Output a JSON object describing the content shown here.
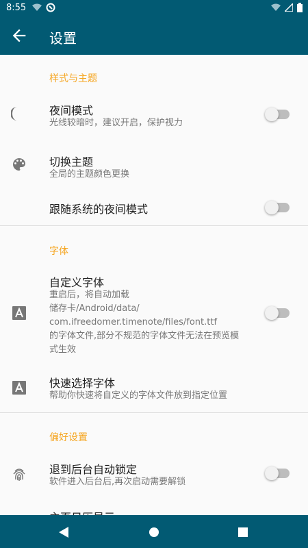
{
  "statusbar": {
    "time": "8:55"
  },
  "appbar": {
    "title": "设置"
  },
  "sections": {
    "style": {
      "title": "样式与主题"
    },
    "font": {
      "title": "字体"
    },
    "prefs": {
      "title": "偏好设置"
    }
  },
  "items": {
    "night_mode": {
      "title": "夜间模式",
      "summary": "光线较暗时，建议开启，保护视力",
      "enabled": false
    },
    "theme": {
      "title": "切换主题",
      "summary": "全局的主题颜色更换"
    },
    "follow_system": {
      "title": "跟随系统的夜间模式",
      "enabled": false
    },
    "custom_font": {
      "title": "自定义字体",
      "summary_line1": "重启后，将自动加载",
      "summary_line2": "储存卡/Android/data/",
      "summary_line3": "com.ifreedomer.timenote/files/font.ttf",
      "summary_line4": "的字体文件,部分不规范的字体文件无法在预览模",
      "summary_line5": "式生效",
      "enabled": false
    },
    "quick_font": {
      "title": "快速选择字体",
      "summary": "帮助你快速将自定义的字体文件放到指定位置"
    },
    "auto_lock": {
      "title": "退到后台自动锁定",
      "summary": "软件进入后台后,再次启动需要解锁",
      "enabled": false
    },
    "home_show": {
      "title": "主页日历显示"
    }
  },
  "colors": {
    "primary": "#025a73",
    "accent": "#f5a623"
  }
}
